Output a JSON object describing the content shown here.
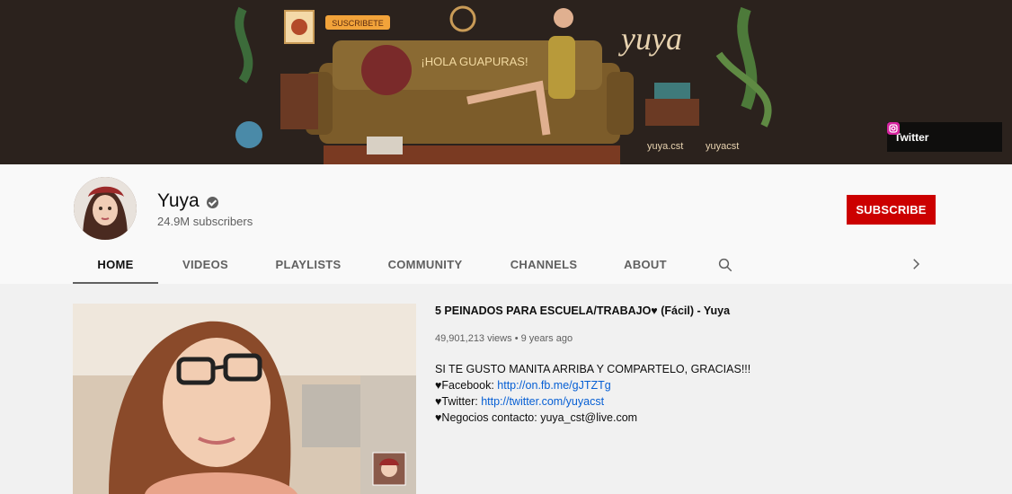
{
  "banner": {
    "sign_text": "SUSCRIBETE",
    "sofa_text": "¡HOLA GUAPURAS!",
    "script_text": "yuya",
    "handles": [
      "yuya.cst",
      "yuyacst"
    ],
    "links": {
      "twitter_label": "Twitter"
    }
  },
  "channel": {
    "name": "Yuya",
    "subscribers": "24.9M subscribers",
    "subscribe_label": "SUBSCRIBE"
  },
  "tabs": [
    "HOME",
    "VIDEOS",
    "PLAYLISTS",
    "COMMUNITY",
    "CHANNELS",
    "ABOUT"
  ],
  "active_tab": "HOME",
  "featured": {
    "title": "5 PEINADOS PARA ESCUELA/TRABAJO♥ (Fácil) - Yuya",
    "views": "49,901,213 views",
    "separator": "•",
    "age": "9 years ago",
    "desc_line1": "SI TE GUSTO MANITA ARRIBA Y COMPARTELO, GRACIAS!!!",
    "fb_label": "♥Facebook: ",
    "fb_link": "http://on.fb.me/gJTZTg",
    "tw_label": "♥Twitter: ",
    "tw_link": "http://twitter.com/yuyacst",
    "biz": "♥Negocios contacto: yuya_cst@live.com"
  },
  "colors": {
    "subscribe": "#cc0000",
    "link": "#065fd4",
    "banner_bg": "#2b221d"
  }
}
